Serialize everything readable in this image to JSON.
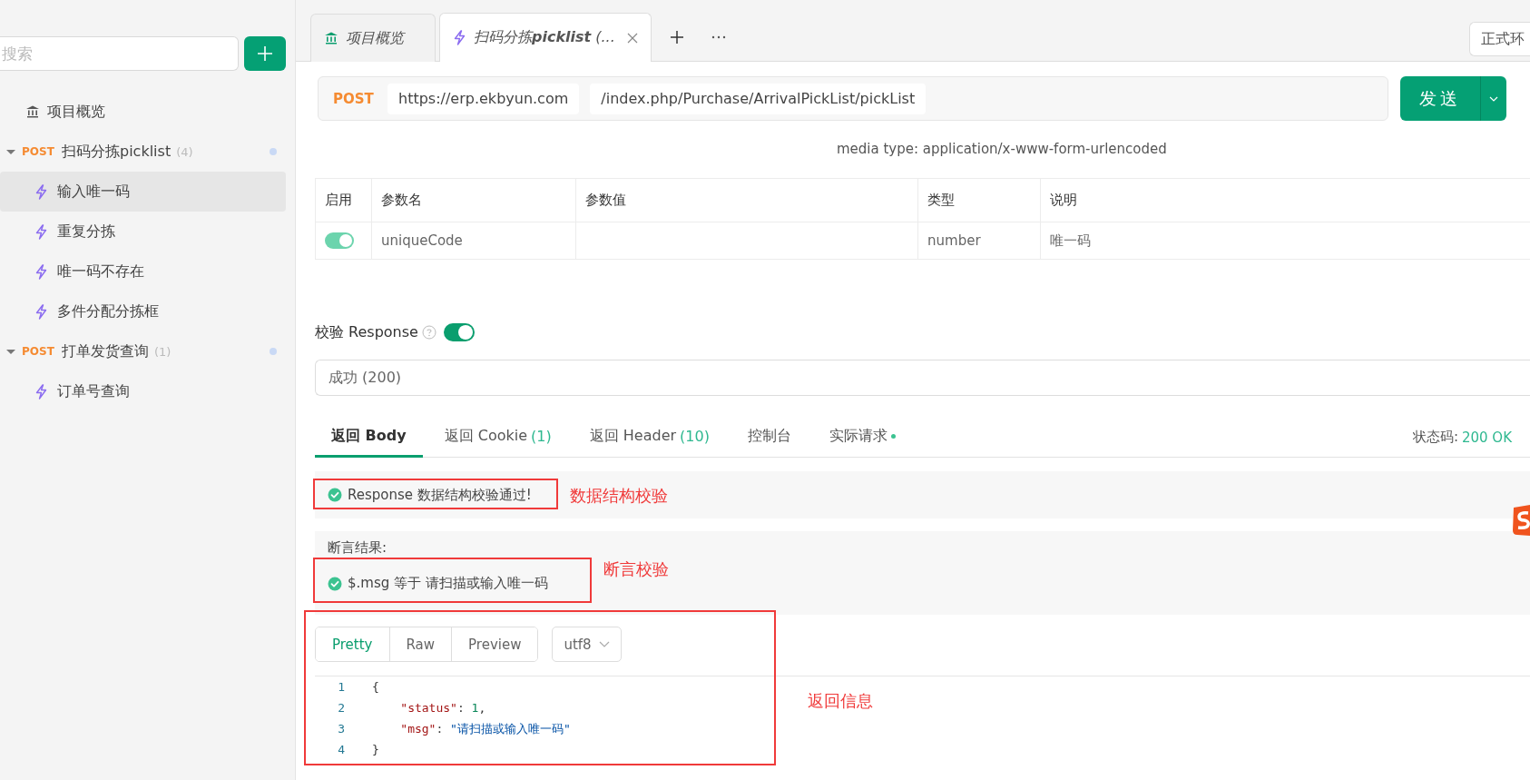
{
  "sidebar": {
    "search": {
      "placeholder": "搜索"
    },
    "items": [
      {
        "kind": "overview",
        "label": "项目概览",
        "selected": false
      },
      {
        "kind": "group",
        "method": "POST",
        "label": "扫码分拣picklist",
        "count": "(4)",
        "expanded": true,
        "children": [
          {
            "label": "输入唯一码",
            "selected": true
          },
          {
            "label": "重复分拣",
            "selected": false
          },
          {
            "label": "唯一码不存在",
            "selected": false
          },
          {
            "label": "多件分配分拣框",
            "selected": false
          }
        ]
      },
      {
        "kind": "group",
        "method": "POST",
        "label": "打单发货查询",
        "count": "(1)",
        "expanded": true,
        "children": [
          {
            "label": "订单号查询",
            "selected": false
          }
        ]
      }
    ]
  },
  "tabs": [
    {
      "kind": "overview",
      "label": "项目概览",
      "selected": false
    },
    {
      "kind": "api",
      "label": "扫码分拣**picklist** (...",
      "selected": true
    }
  ],
  "environment": "正式环",
  "request": {
    "method": "POST",
    "base_url": "https://erp.ekbyun.com",
    "path": "/index.php/Purchase/ArrivalPickList/pickList",
    "send": "发送"
  },
  "media_type": "media type: application/x-www-form-urlencoded",
  "params": {
    "columns": [
      "启用",
      "参数名",
      "参数值",
      "类型",
      "说明"
    ],
    "rows": [
      {
        "enabled": true,
        "name": "uniqueCode",
        "type": "number",
        "description": "唯一码"
      }
    ]
  },
  "validate": {
    "label": "校验 Response",
    "on": true,
    "value": "成功 (200)"
  },
  "response_tabs": [
    {
      "label": "返回 Body",
      "selected": true,
      "dot": false
    },
    {
      "label": "返回 Cookie",
      "count": "(1)",
      "selected": false,
      "dot": false
    },
    {
      "label": "返回 Header",
      "count": "(10)",
      "selected": false,
      "dot": false
    },
    {
      "label": "控制台",
      "selected": false,
      "dot": false
    },
    {
      "label": "实际请求",
      "selected": false,
      "dot": true
    }
  ],
  "status": {
    "label": "状态码:",
    "value": "200 OK"
  },
  "schema_check": {
    "passed": true,
    "text": "Response 数据结构校验通过!"
  },
  "assertions": {
    "title": "断言结果:",
    "items": [
      {
        "passed": true,
        "text": "$.msg 等于 请扫描或输入唯一码"
      }
    ]
  },
  "view_modes": [
    {
      "label": "Pretty",
      "selected": true
    },
    {
      "label": "Raw",
      "selected": false
    },
    {
      "label": "Preview",
      "selected": false
    }
  ],
  "encoding": "utf8",
  "code": [
    {
      "number": "1",
      "tokens": [
        {
          "kind": "punct",
          "text": "{"
        }
      ]
    },
    {
      "number": "2",
      "tokens": [
        {
          "kind": "key",
          "text": "    \"status\""
        },
        {
          "kind": "punct",
          "text": ": "
        },
        {
          "kind": "number",
          "text": "1"
        },
        {
          "kind": "punct",
          "text": ","
        }
      ]
    },
    {
      "number": "3",
      "tokens": [
        {
          "kind": "key",
          "text": "    \"msg\""
        },
        {
          "kind": "punct",
          "text": ": "
        },
        {
          "kind": "string",
          "text": "\"请扫描或输入唯一码\""
        }
      ]
    },
    {
      "number": "4",
      "tokens": [
        {
          "kind": "punct",
          "text": "}"
        }
      ]
    }
  ],
  "annotations": [
    {
      "label": "数据结构校验"
    },
    {
      "label": "断言校验"
    },
    {
      "label": "返回信息"
    }
  ]
}
